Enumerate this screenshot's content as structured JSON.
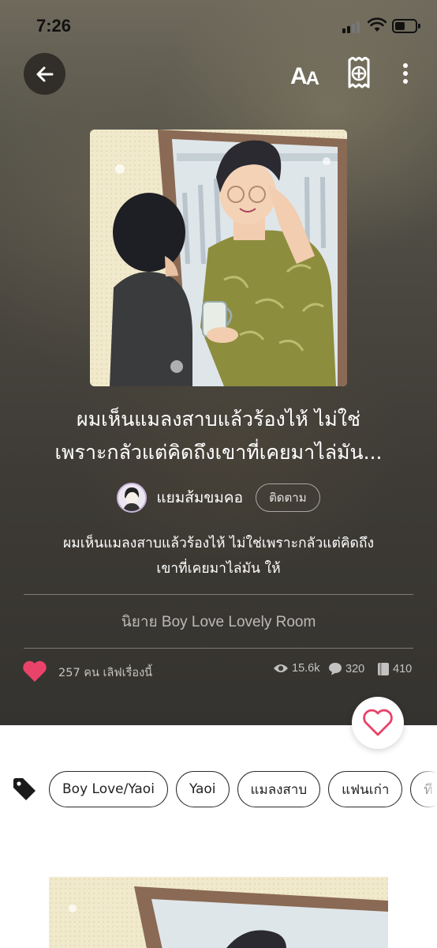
{
  "status_bar": {
    "time": "7:26"
  },
  "toolbar": {
    "back": "arrow-left-icon",
    "font_size_label_big": "A",
    "font_size_label_small": "A",
    "add_library": "add-to-library-icon",
    "more": "more-vertical-icon"
  },
  "story": {
    "title_line1": "ผมเห็นแมลงสาบแล้วร้องไห้ ไม่ใช่",
    "title_line2": "เพราะกลัวแต่คิดถึงเขาที่เคยมาไล่มัน...",
    "author": "แยมส้มขมคอ",
    "follow_label": "ติดตาม",
    "synopsis_line1": "ผมเห็นแมลงสาบแล้วร้องไห้ ไม่ใช่เพราะกลัวแต่คิดถึง",
    "synopsis_line2": "เขาที่เคยมาไล่มัน ให้",
    "category": "นิยาย Boy Love Lovely Room"
  },
  "stats": {
    "likes_text": "257 คน เลิฟเรื่องนี้",
    "views": "15.6k",
    "comments": "320",
    "chapters": "410"
  },
  "tags": [
    "Boy Love/Yaoi",
    "Yaoi",
    "แมลงสาบ",
    "แฟนเก่า",
    "ที"
  ],
  "colors": {
    "heart": "#e9436a",
    "hero_bg": "#45423c"
  }
}
